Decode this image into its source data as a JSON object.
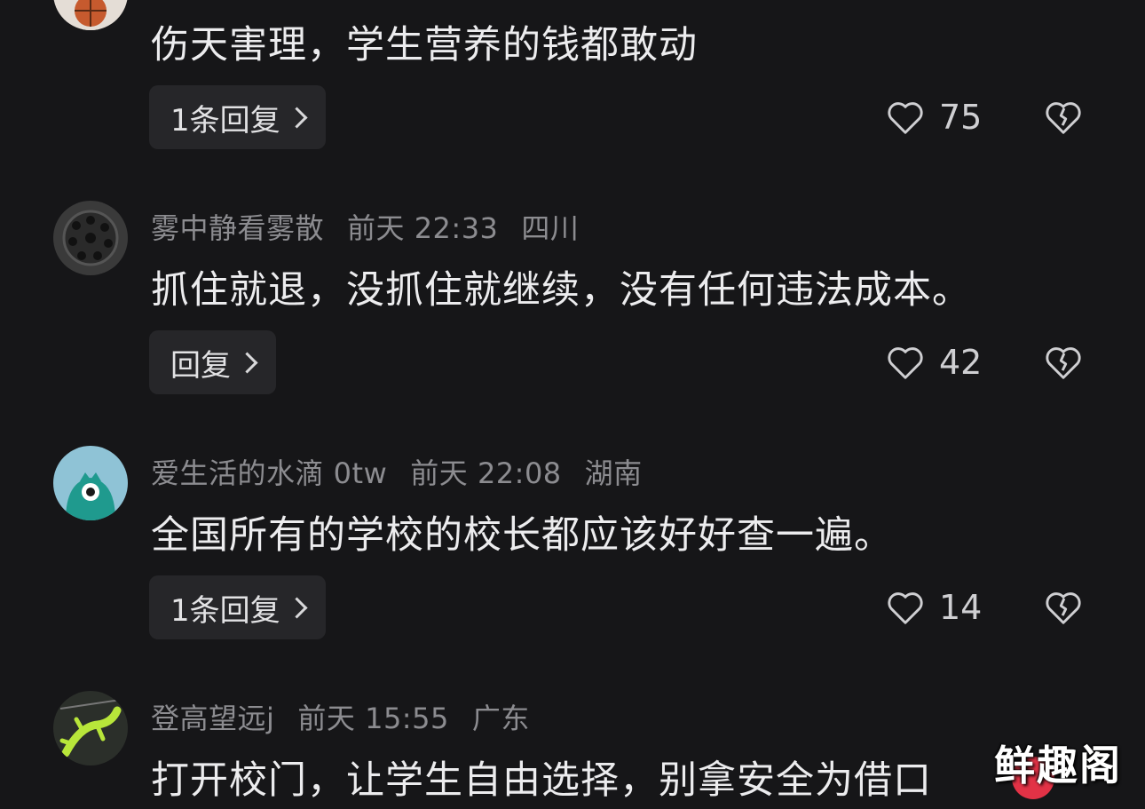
{
  "comments": [
    {
      "username": "",
      "time": "",
      "location": "",
      "text": "伤天害理，学生营养的钱都敢动",
      "reply_label": "1条回复",
      "likes": "75"
    },
    {
      "username": "雾中静看雾散",
      "time": "前天 22:33",
      "location": "四川",
      "text": "抓住就退，没抓住就继续，没有任何违法成本。",
      "reply_label": "回复",
      "likes": "42"
    },
    {
      "username": "爱生活的水滴 0tw",
      "time": "前天 22:08",
      "location": "湖南",
      "text": "全国所有的学校的校长都应该好好查一遍。",
      "reply_label": "1条回复",
      "likes": "14"
    },
    {
      "username": "登高望远j",
      "time": "前天 15:55",
      "location": "广东",
      "text": "打开校门，让学生自由选择，别拿安全为借口",
      "reply_label": "",
      "likes": ""
    }
  ],
  "watermark": "鲜趣阁",
  "colors": {
    "background": "#161618",
    "button_bg": "#262629",
    "meta_text": "#8c8c90",
    "body_text": "#ececee",
    "watermark_badge": "#e23246"
  },
  "icons": {
    "like": "heart-outline-icon",
    "dislike": "broken-heart-icon",
    "chevron": "chevron-right-icon"
  }
}
